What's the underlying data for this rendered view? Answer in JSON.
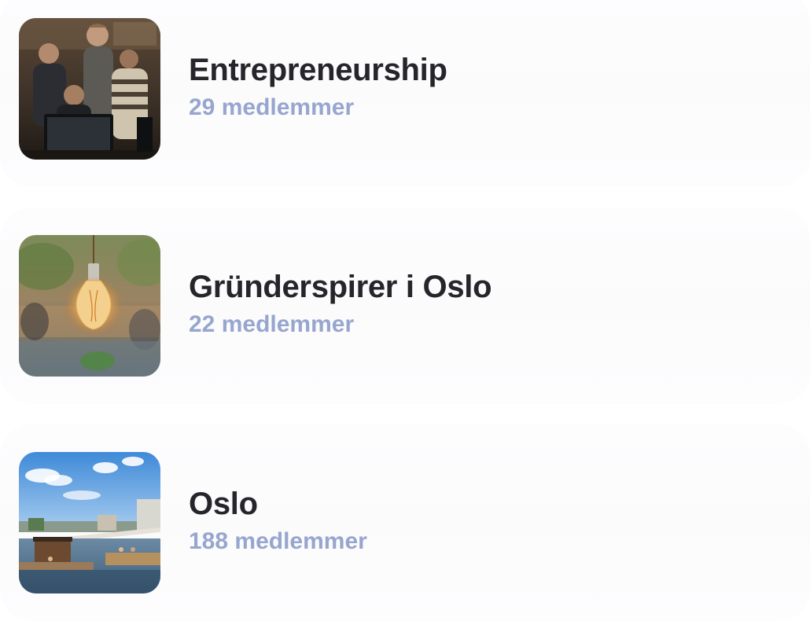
{
  "groups": [
    {
      "name": "Entrepreneurship",
      "members": "29 medlemmer",
      "image_icon": "people-at-computer-photo"
    },
    {
      "name": "Gründerspirer i Oslo",
      "members": "22 medlemmer",
      "image_icon": "lightbulb-photo"
    },
    {
      "name": "Oslo",
      "members": "188 medlemmer",
      "image_icon": "harbor-city-photo"
    }
  ],
  "colors": {
    "title": "#25252b",
    "members": "#97a6cf",
    "row_background": "#fbfbfc"
  }
}
